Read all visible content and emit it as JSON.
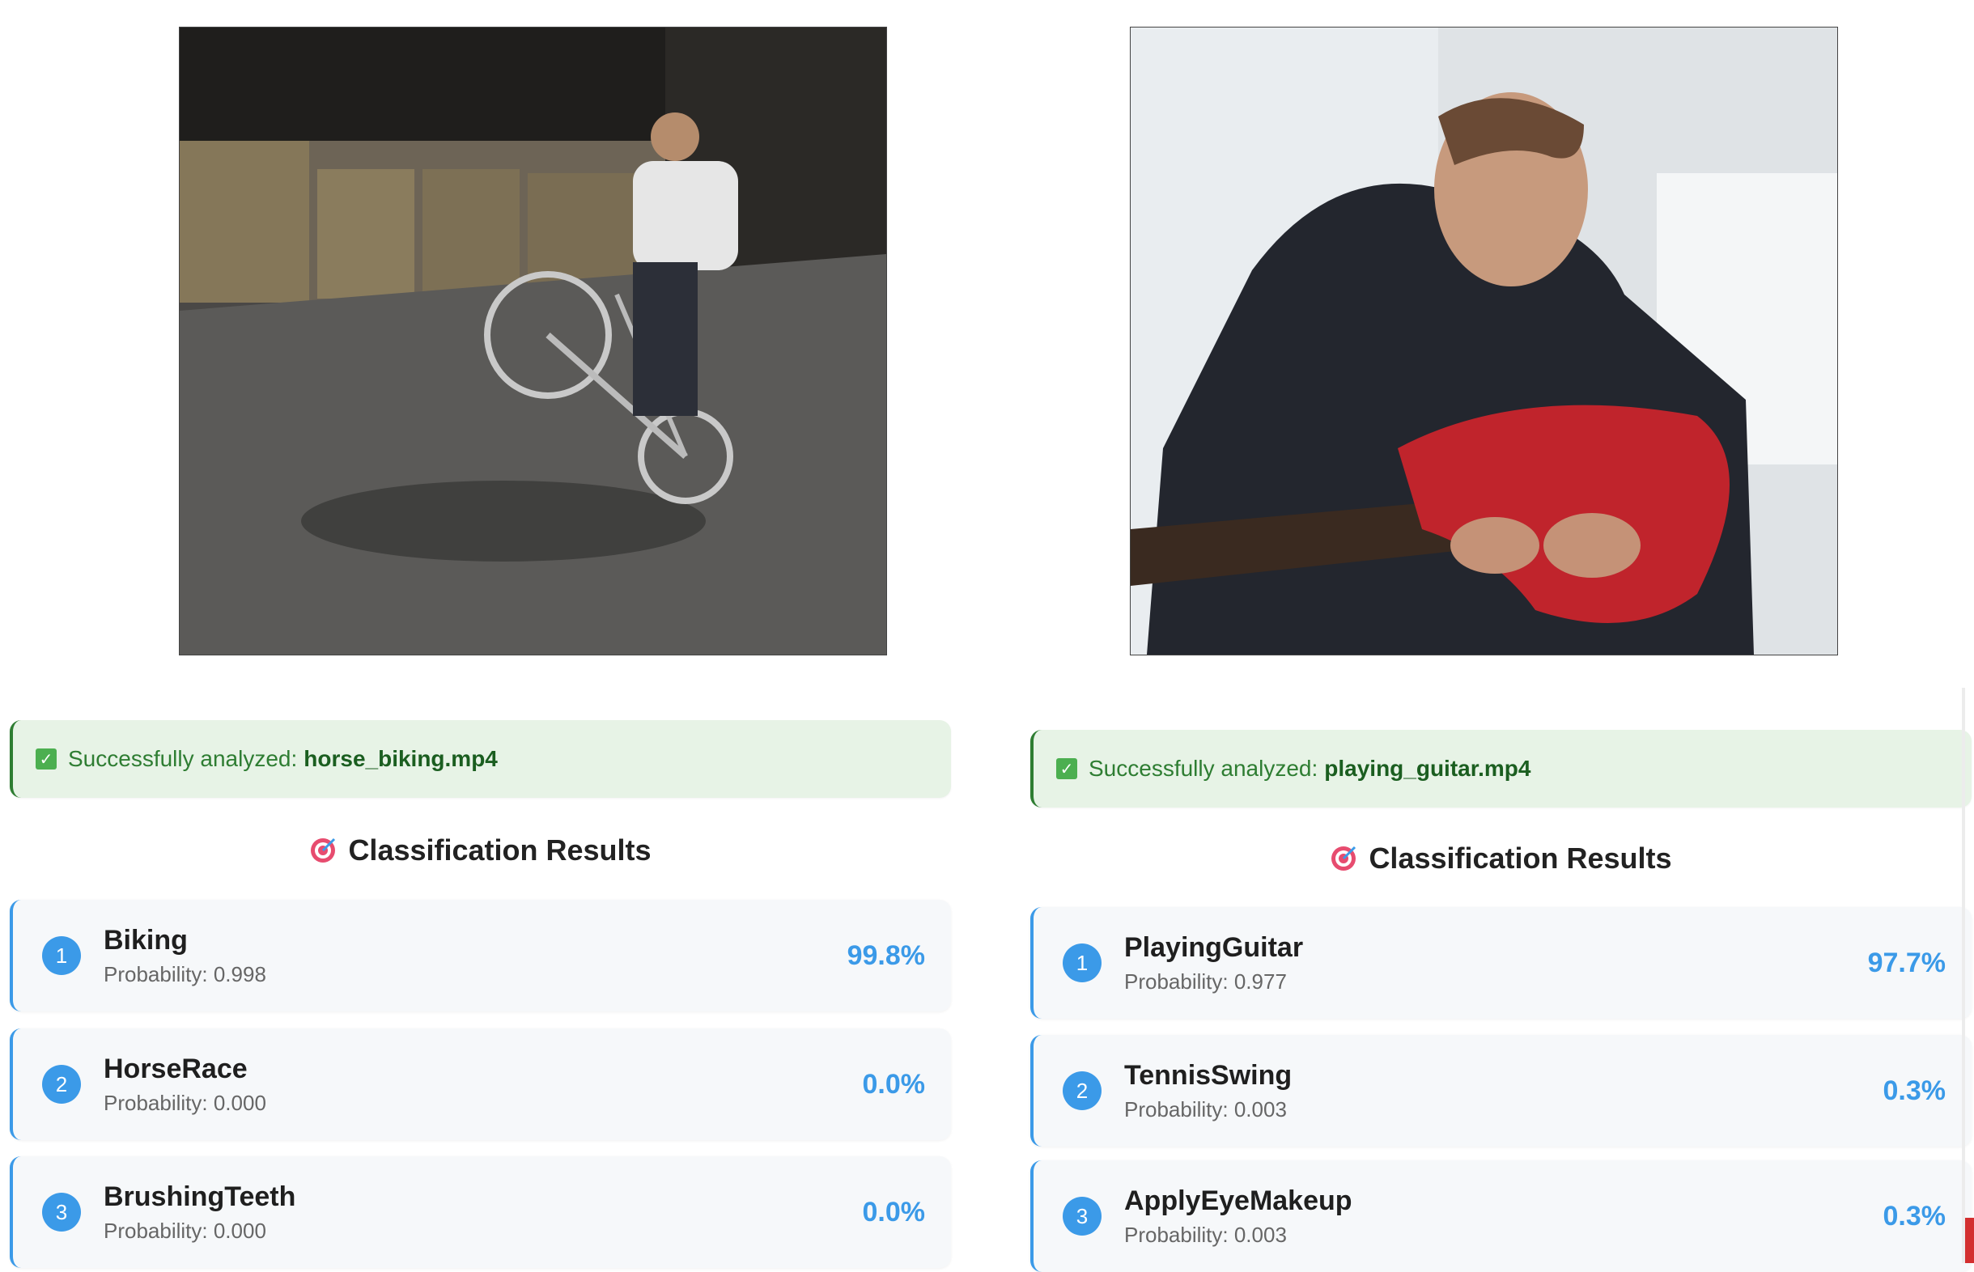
{
  "panels": [
    {
      "status_prefix": "Successfully analyzed:",
      "filename": "horse_biking.mp4",
      "results_title": "Classification Results",
      "results": [
        {
          "rank": "1",
          "label": "Biking",
          "prob_text": "Probability: 0.998",
          "percent": "99.8%"
        },
        {
          "rank": "2",
          "label": "HorseRace",
          "prob_text": "Probability: 0.000",
          "percent": "0.0%"
        },
        {
          "rank": "3",
          "label": "BrushingTeeth",
          "prob_text": "Probability: 0.000",
          "percent": "0.0%"
        }
      ]
    },
    {
      "status_prefix": "Successfully analyzed:",
      "filename": "playing_guitar.mp4",
      "results_title": "Classification Results",
      "results": [
        {
          "rank": "1",
          "label": "PlayingGuitar",
          "prob_text": "Probability: 0.977",
          "percent": "97.7%"
        },
        {
          "rank": "2",
          "label": "TennisSwing",
          "prob_text": "Probability: 0.003",
          "percent": "0.3%"
        },
        {
          "rank": "3",
          "label": "ApplyEyeMakeup",
          "prob_text": "Probability: 0.003",
          "percent": "0.3%"
        }
      ]
    }
  ],
  "icons": {
    "status": "check-box-icon",
    "results": "target-icon"
  },
  "colors": {
    "success_bg": "#e7f3e6",
    "success_text": "#2e7d32",
    "accent": "#3b9ae8",
    "card_bg": "#f6f8fa"
  }
}
